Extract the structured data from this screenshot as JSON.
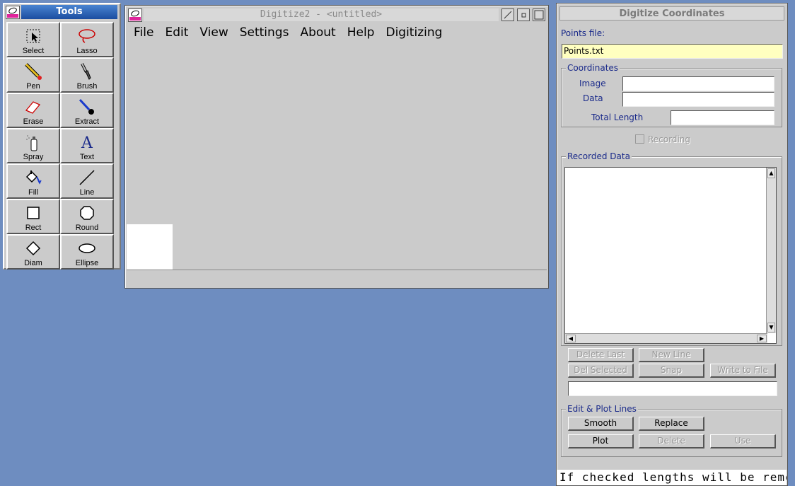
{
  "tools": {
    "title": "Tools",
    "items": [
      {
        "label": "Select",
        "icon": "select-icon"
      },
      {
        "label": "Lasso",
        "icon": "lasso-icon"
      },
      {
        "label": "Pen",
        "icon": "pen-icon"
      },
      {
        "label": "Brush",
        "icon": "brush-icon"
      },
      {
        "label": "Erase",
        "icon": "eraser-icon"
      },
      {
        "label": "Extract",
        "icon": "extract-icon"
      },
      {
        "label": "Spray",
        "icon": "spray-icon"
      },
      {
        "label": "Text",
        "icon": "text-icon"
      },
      {
        "label": "Fill",
        "icon": "fill-icon"
      },
      {
        "label": "Line",
        "icon": "line-icon"
      },
      {
        "label": "Rect",
        "icon": "rect-icon"
      },
      {
        "label": "Round",
        "icon": "round-rect-icon"
      },
      {
        "label": "Diam",
        "icon": "diamond-icon"
      },
      {
        "label": "Ellipse",
        "icon": "ellipse-icon"
      }
    ]
  },
  "main_window": {
    "title": "Digitize2 - <untitled>",
    "menu": [
      "File",
      "Edit",
      "View",
      "Settings",
      "About",
      "Help",
      "Digitizing"
    ]
  },
  "coords_panel": {
    "title": "Digitize Coordinates",
    "points_file_label": "Points file:",
    "points_file_value": "Points.txt",
    "coordinates_group": "Coordinates",
    "image_label": "Image",
    "data_label": "Data",
    "total_length_label": "Total Length",
    "recording_label": "Recording",
    "recorded_data_group": "Recorded Data",
    "buttons": {
      "delete_last": "Delete Last",
      "new_line": "New Line",
      "del_selected": "Del Selected",
      "snap": "Snap",
      "write_to_file": "Write to File"
    },
    "edit_plot_group": "Edit & Plot Lines",
    "edit_buttons": {
      "smooth": "Smooth",
      "replace": "Replace",
      "plot": "Plot",
      "delete": "Delete",
      "use": "Use"
    },
    "status_text": "If checked lengths will be remer"
  },
  "colors": {
    "desktop": "#6e8dc0",
    "window": "#cbcbcb",
    "tools_title": "#1a4da0",
    "points_file_bg": "#ffffc0",
    "label_navy": "#1a2a8a"
  }
}
